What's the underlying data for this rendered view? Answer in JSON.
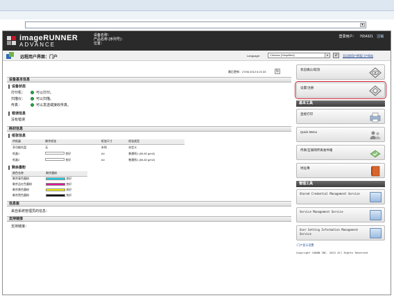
{
  "header": {
    "brand_line1": "imageRUNNER",
    "brand_line2": "ADVANCE",
    "device_name_label": "设备名称：",
    "product_name_label": "产品名称 (序列号)：",
    "location_label": "位置：",
    "login_user_label": "登录用户：",
    "login_user_value": "7654321",
    "logout_label": "注销"
  },
  "titlebar": {
    "title": "远程用户界面：门户",
    "language_label": "Language:",
    "language_value": "Chinese (Simplified)",
    "sitemap_link": "至远程用户界面门户网站"
  },
  "last_update": "最后更新：27/06 2012 6:21:33",
  "device_basic": {
    "section_title": "设备基本信息",
    "status": {
      "title": "设备状态",
      "rows": [
        {
          "label": "打印机：",
          "value": "可以打印。"
        },
        {
          "label": "扫描仪：",
          "value": "可以扫描。"
        },
        {
          "label": "传真：",
          "value": "可以发送或接收传真。"
        }
      ]
    },
    "error": {
      "title": "错误信息",
      "value": "没有错误"
    }
  },
  "consumables": {
    "section_title": "耗材信息",
    "paper": {
      "title": "纸张信息",
      "headers": [
        "供纸器",
        "剩余纸张",
        "纸张尺寸",
        "纸张类型"
      ],
      "rows": [
        {
          "source": "多功能托盘",
          "remaining": "无",
          "size": "未知",
          "type": "未定义"
        },
        {
          "source": "纸盒1",
          "remaining": "良好",
          "size": "A4",
          "type": "普通纸1 (65-82 g/m2)"
        },
        {
          "source": "纸盒2",
          "remaining": "良好",
          "size": "A4",
          "type": "普通纸1 (65-82 g/m2)"
        }
      ]
    },
    "toner": {
      "title": "剩余墨粉",
      "headers": [
        "颜色名称",
        "剩余墨粉"
      ],
      "rows": [
        {
          "name": "剩余青色墨粉",
          "color": "#22d4ee",
          "level": "良好"
        },
        {
          "name": "剩余品红色墨粉",
          "color": "#e0169c",
          "level": "良好"
        },
        {
          "name": "剩余黄色墨粉",
          "color": "#f2f20a",
          "level": "良好"
        },
        {
          "name": "剩余黑色墨粉",
          "color": "#111111",
          "level": "良好"
        }
      ]
    }
  },
  "messages": {
    "section_title": "信息板",
    "value": "来自系统管理员的信息："
  },
  "support": {
    "section_title": "支持链接",
    "value": "支持链接："
  },
  "sidebar": {
    "status_monitor": "状态确认/取消",
    "settings": "设置/注册",
    "basic_tools_title": "基本工具",
    "basic_tools": [
      "直接打印",
      "Quick Menu",
      "传真/互联网传真收件箱",
      "地址簿"
    ],
    "management_tools_title": "管理工具",
    "management_tools": [
      "Shared Credential Management Service",
      "Service Management Service",
      "User Setting Information Management Service"
    ],
    "portal_display_link": "门户显示设置",
    "copyright": "Copyright CANON INC. 2012 All Rights Reserved"
  },
  "colors": {
    "header_bg": "#2a2a2a",
    "accent_red": "#c0182a",
    "ok_green": "#2aa84a",
    "link_blue": "#1a3e8c"
  }
}
